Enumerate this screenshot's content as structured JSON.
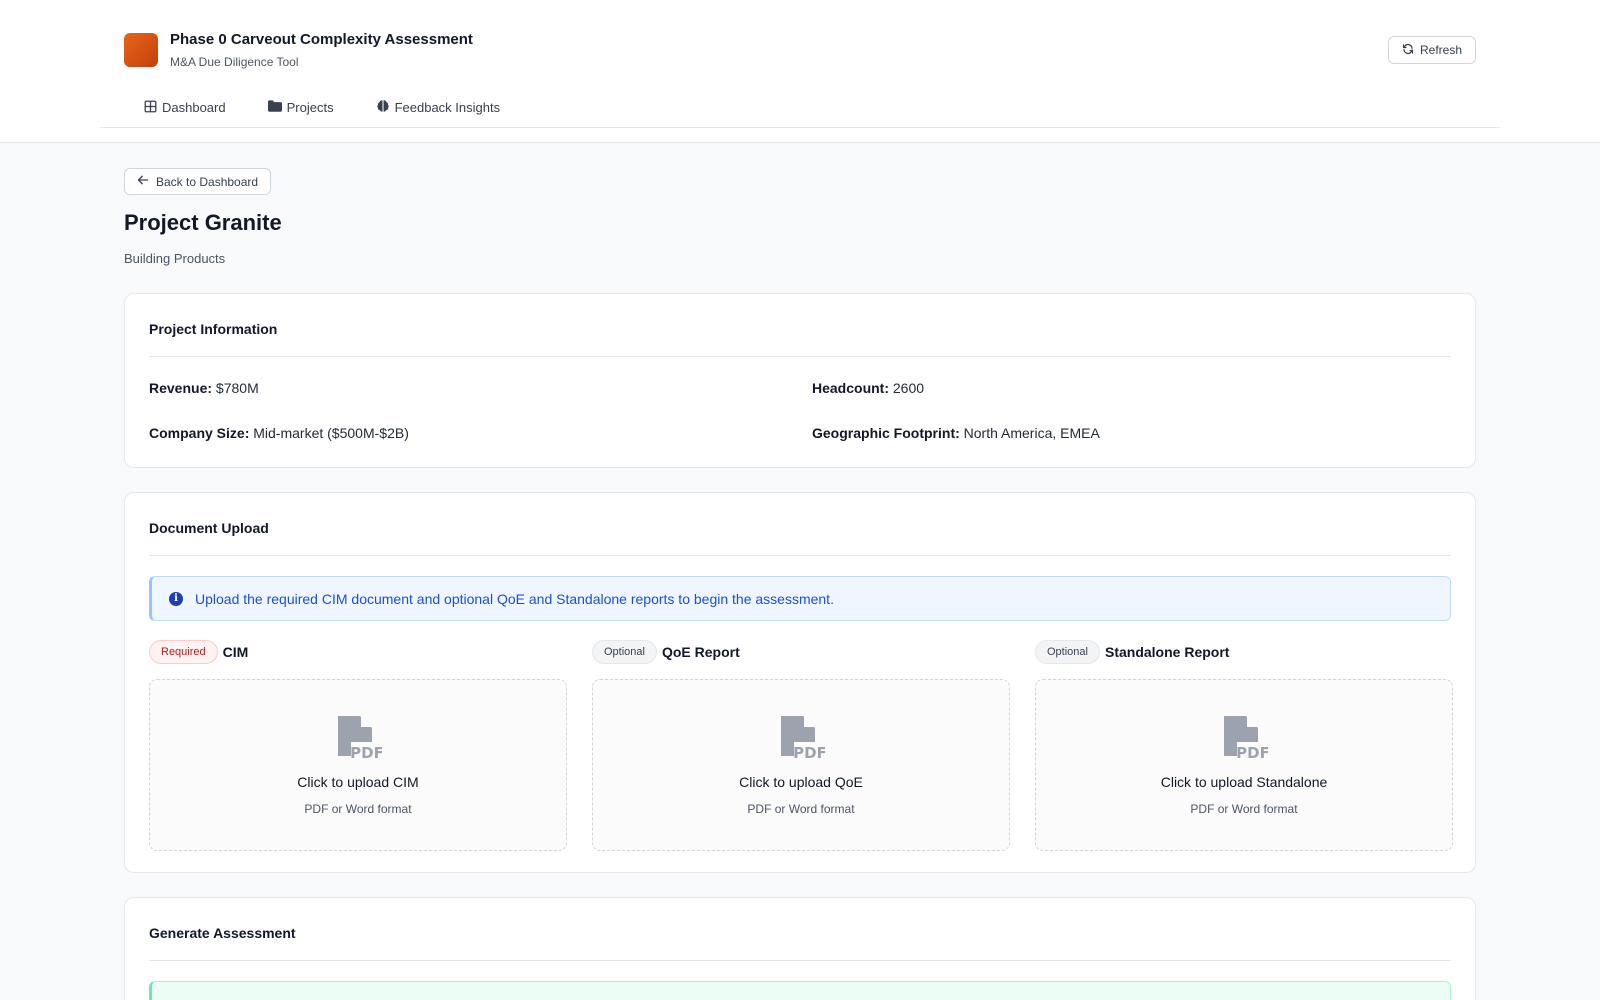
{
  "app": {
    "title": "Phase 0 Carveout Complexity Assessment",
    "subtitle": "M&A Due Diligence Tool",
    "refresh_label": "Refresh"
  },
  "nav": {
    "items": [
      {
        "label": "Dashboard",
        "icon": "grid-icon"
      },
      {
        "label": "Projects",
        "icon": "folder-icon"
      },
      {
        "label": "Feedback Insights",
        "icon": "brain-icon"
      }
    ]
  },
  "page": {
    "back_label": "Back to Dashboard",
    "title": "Project Granite",
    "subtitle": "Building Products"
  },
  "project_info": {
    "heading": "Project Information",
    "fields": [
      {
        "label": "Revenue:",
        "value": "$780M"
      },
      {
        "label": "Headcount:",
        "value": "2600"
      },
      {
        "label": "Company Size:",
        "value": "Mid-market ($500M-$2B)"
      },
      {
        "label": "Geographic Footprint:",
        "value": "North America, EMEA"
      }
    ]
  },
  "document_upload": {
    "heading": "Document Upload",
    "alert": "Upload the required CIM document and optional QoE and Standalone reports to begin the assessment.",
    "slots": [
      {
        "badge": "Required",
        "label": "CIM",
        "cta": "Click to upload CIM",
        "hint": "PDF or Word format"
      },
      {
        "badge": "Optional",
        "label": "QoE Report",
        "cta": "Click to upload QoE",
        "hint": "PDF or Word format"
      },
      {
        "badge": "Optional",
        "label": "Standalone Report",
        "cta": "Click to upload Standalone",
        "hint": "PDF or Word format"
      }
    ]
  },
  "generate": {
    "heading": "Generate Assessment"
  },
  "colors": {
    "brand": "#e8641b",
    "info": "#1d4ed8",
    "required": "#b91c1c",
    "success": "#ecfdf5"
  }
}
